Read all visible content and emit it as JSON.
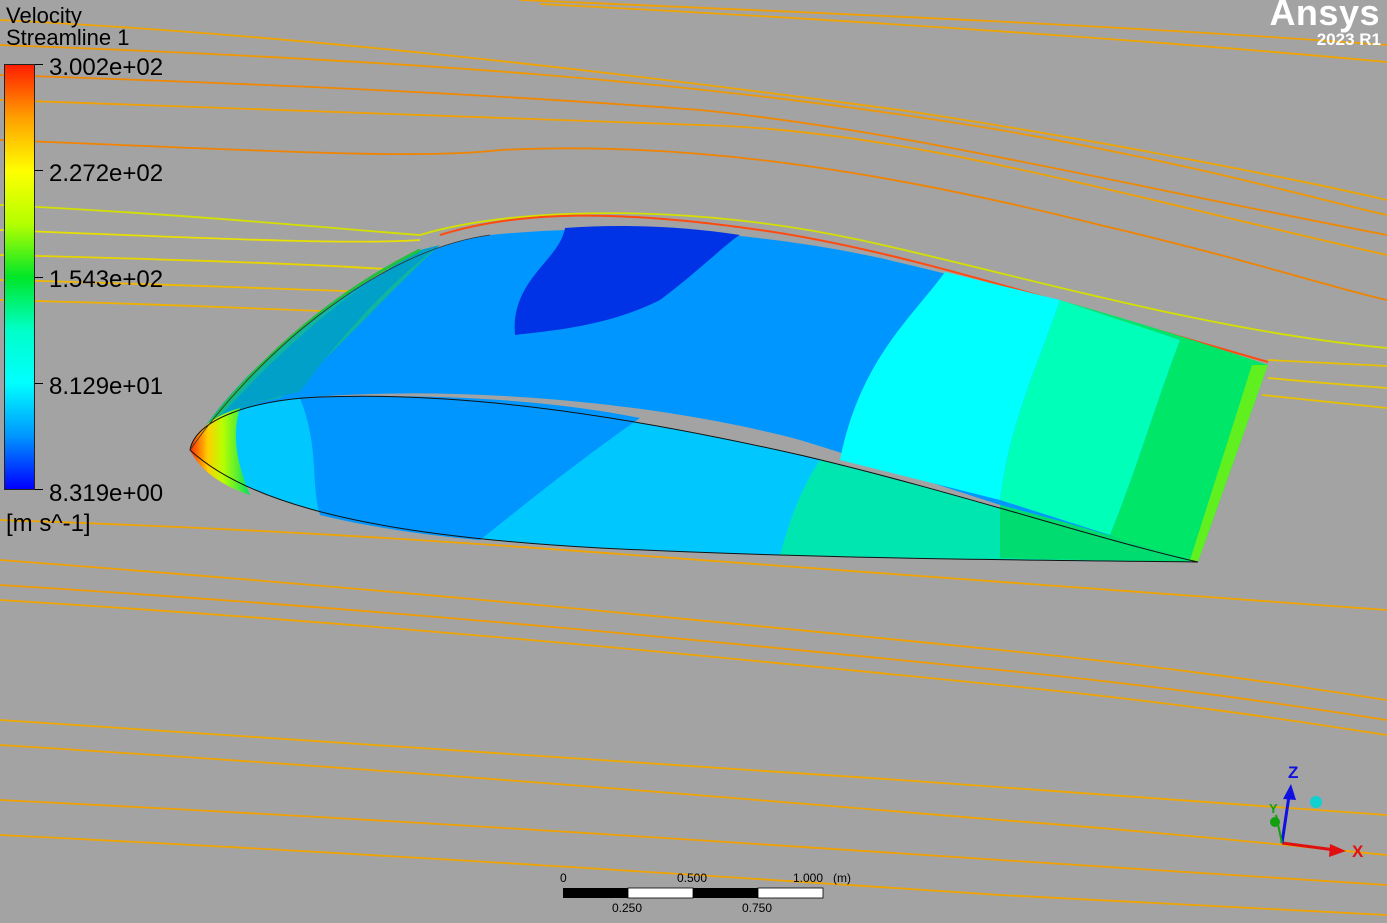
{
  "legend": {
    "variable": "Velocity",
    "object": "Streamline 1",
    "max_label": "3.002e+02",
    "labels": [
      "3.002e+02",
      "2.272e+02",
      "1.543e+02",
      "8.129e+01",
      "8.319e+00"
    ],
    "units": "[m s^-1]",
    "colormap": [
      "#ff1e00",
      "#ffa000",
      "#ffff00",
      "#b4ff00",
      "#00e628",
      "#00ffc8",
      "#00ffff",
      "#0096ff",
      "#0000ff"
    ]
  },
  "brand": {
    "name": "Ansys",
    "version": "2023 R1"
  },
  "scale": {
    "top_labels": [
      "0",
      "0.500",
      "1.000"
    ],
    "bottom_labels": [
      "0.250",
      "0.750"
    ],
    "unit": "(m)"
  },
  "axes": {
    "x": "X",
    "y": "Y",
    "z": "Z"
  },
  "colors": {
    "background": "#a3a3a3",
    "streamline": "#f0a400",
    "axis_x": "#e01010",
    "axis_y": "#10a010",
    "axis_z": "#1010e0"
  }
}
